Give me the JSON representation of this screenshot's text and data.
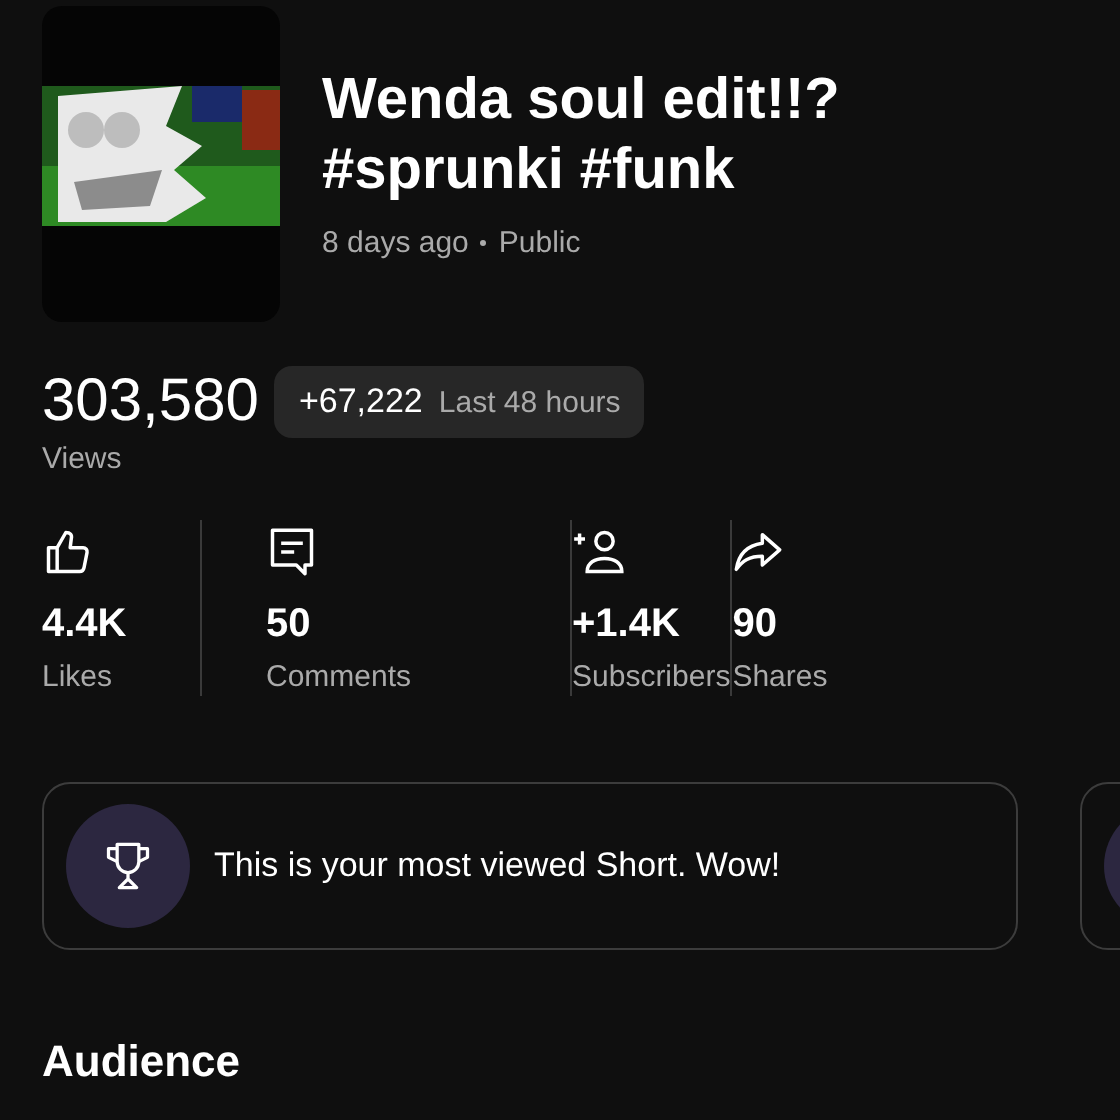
{
  "video": {
    "title": "Wenda soul edit!!? #sprunki #funk",
    "age": "8 days ago",
    "visibility": "Public"
  },
  "views": {
    "count": "303,580",
    "label": "Views",
    "change": "+67,222",
    "change_period": "Last 48 hours"
  },
  "stats": [
    {
      "kind": "likes",
      "value": "4.4K",
      "label": "Likes"
    },
    {
      "kind": "comments",
      "value": "50",
      "label": "Comments"
    },
    {
      "kind": "subscribers",
      "value": "+1.4K",
      "label": "Subscribers"
    },
    {
      "kind": "shares",
      "value": "90",
      "label": "Shares"
    }
  ],
  "insight_cards": [
    {
      "kind": "trophy",
      "text": "This is your most viewed Short. Wow!"
    },
    {
      "kind": "partial"
    }
  ],
  "section_heading": "Audience"
}
